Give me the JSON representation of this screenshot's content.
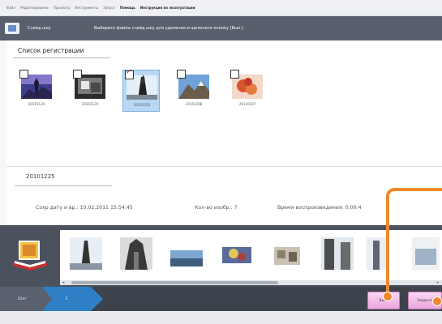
{
  "menu": {
    "items": [
      "Файл",
      "Редактирование",
      "Просмотр",
      "Инструменты",
      "Запуск",
      "Помощь",
      "Инструкция по эксплуатации"
    ],
    "bold_indices": [
      5,
      6
    ]
  },
  "titlebar": {
    "app_title": "Слайд шоу",
    "instruction": "Выберите файлы слайд шоу для удаления и щелкните кнопку [Вып.]"
  },
  "registration": {
    "title": "Список регистрации",
    "items": [
      {
        "caption": "20101120",
        "checked": false,
        "selected": false
      },
      {
        "caption": "20101129",
        "checked": false,
        "selected": false
      },
      {
        "caption": "20101203",
        "checked": true,
        "selected": true
      },
      {
        "caption": "20101208",
        "checked": false,
        "selected": false
      },
      {
        "caption": "20110107",
        "checked": false,
        "selected": false
      }
    ]
  },
  "detail": {
    "date": "20101225",
    "saved_label": "Сохр дату и вр.:",
    "saved_value": "10.02.2011 15:54:45",
    "count_label": "Кол-во изобр.:",
    "count_value": "7",
    "duration_label": "Время воспроизведения:",
    "duration_value": "0:00:4"
  },
  "steps": {
    "step1": "Шаг",
    "step2": "1"
  },
  "buttons": {
    "execute": "Вып.",
    "close": "Закрыть"
  },
  "colors": {
    "accent": "#ee8a2a",
    "selection": "#b8d7f4",
    "titlebar": "#58606e",
    "button": "#f0bde6"
  },
  "icons": {
    "app": "slideshow-icon",
    "filmstrip": "photo-album-icon"
  }
}
